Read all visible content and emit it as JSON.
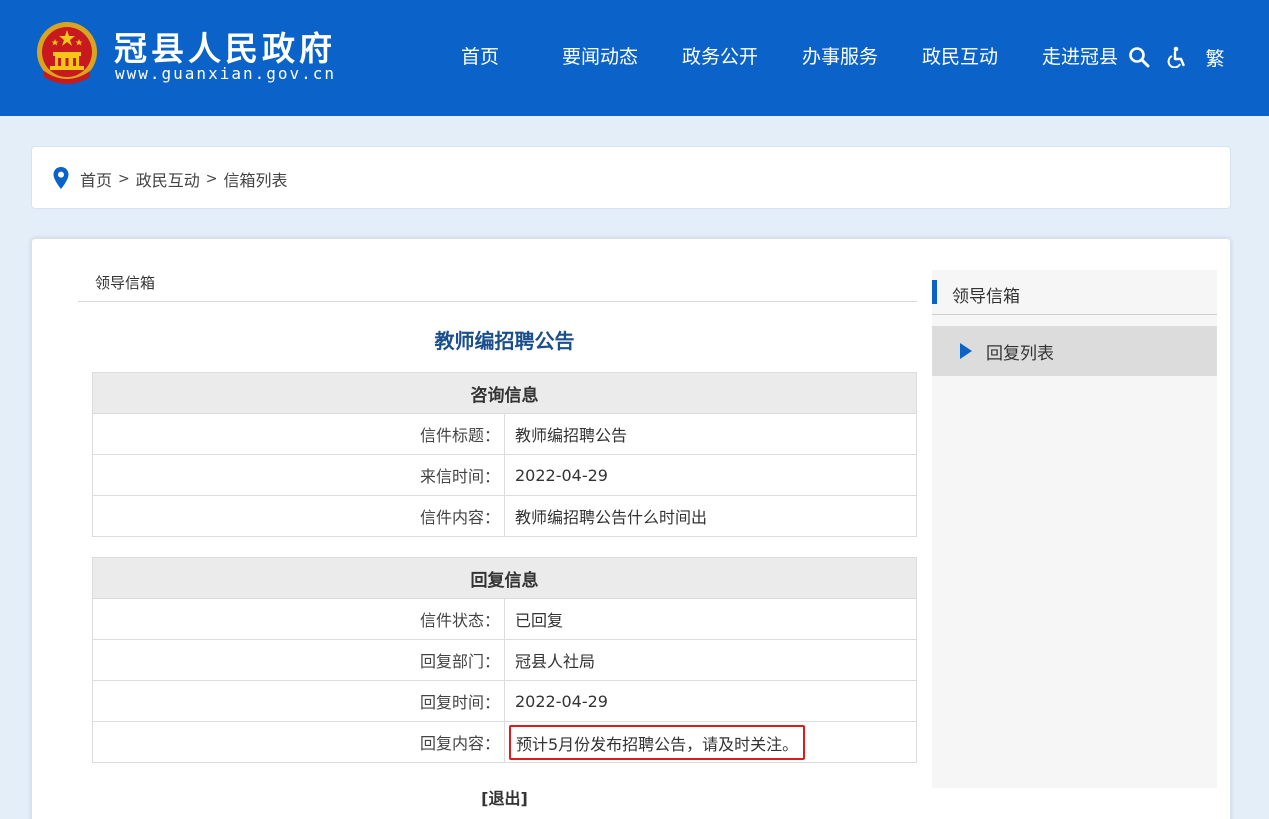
{
  "header": {
    "site_name": "冠县人民政府",
    "site_url": "www.guanxian.gov.cn",
    "brand_color": "#0b62c8",
    "nav": [
      {
        "label": "首页"
      },
      {
        "label": "要闻动态"
      },
      {
        "label": "政务公开"
      },
      {
        "label": "办事服务"
      },
      {
        "label": "政民互动"
      },
      {
        "label": "走进冠县"
      }
    ],
    "tools": {
      "search_icon": "search-icon",
      "accessibility_icon": "wheelchair-icon",
      "traditional_label": "繁"
    }
  },
  "breadcrumb": {
    "icon": "location-pin-icon",
    "items": [
      "首页",
      "政民互动",
      "信箱列表"
    ],
    "separator": ">"
  },
  "main": {
    "section_label": "领导信箱",
    "letter_title": "教师编招聘公告",
    "consult": {
      "heading": "咨询信息",
      "rows": [
        {
          "label": "信件标题：",
          "value": "教师编招聘公告"
        },
        {
          "label": "来信时间：",
          "value": "2022-04-29"
        },
        {
          "label": "信件内容：",
          "value": "教师编招聘公告什么时间出"
        }
      ]
    },
    "reply": {
      "heading": "回复信息",
      "rows": [
        {
          "label": "信件状态：",
          "value": "已回复"
        },
        {
          "label": "回复部门：",
          "value": "冠县人社局"
        },
        {
          "label": "回复时间：",
          "value": "2022-04-29"
        },
        {
          "label": "回复内容：",
          "value": "预计5月份发布招聘公告，请及时关注。"
        }
      ]
    },
    "exit_label": "[退出]"
  },
  "side": {
    "title": "领导信箱",
    "items": [
      {
        "label": "回复列表"
      }
    ]
  }
}
